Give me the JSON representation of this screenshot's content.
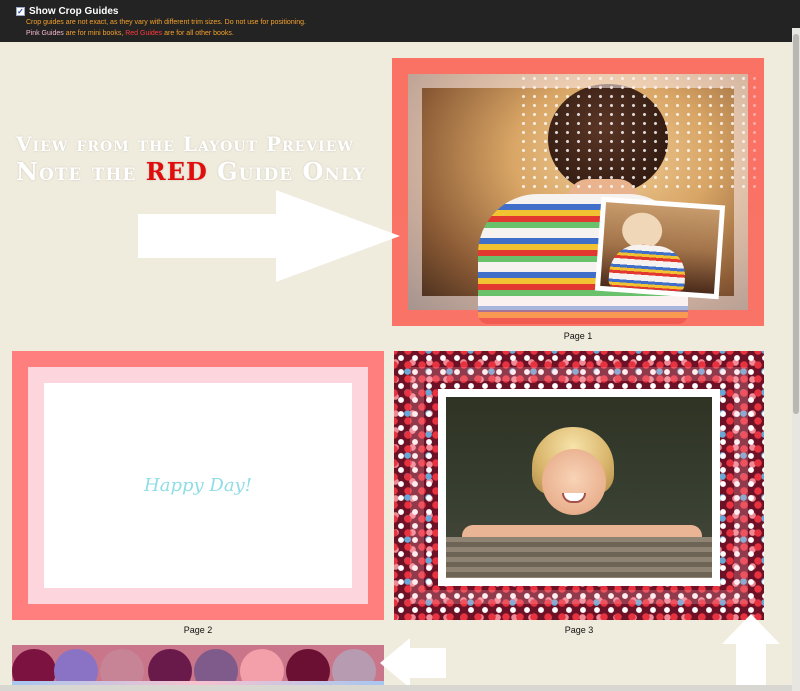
{
  "top_bar": {
    "checkbox_checked": true,
    "title": "Show Crop Guides",
    "note1": "Crop guides are not exact, as they vary with different trim sizes. Do not use for positioning.",
    "note2": {
      "pink_guides": "Pink Guides",
      "text_a": " are for mini books, ",
      "red_guides": "Red Guides",
      "text_b": " are for all other books."
    }
  },
  "annotation": {
    "line1": "View from the Layout Preview",
    "line2_prefix": "Note the ",
    "line2_highlight": "RED",
    "line2_suffix": " Guide Only"
  },
  "pages": [
    {
      "label": "Page 1"
    },
    {
      "label": "Page 2",
      "text": "Happy Day!"
    },
    {
      "label": "Page 3"
    }
  ],
  "colors": {
    "background": "#efebdd",
    "top_bar": "#232323",
    "red_guide": "#ff7f7f",
    "pink_guide": "#fcd6dc",
    "annotation_highlight": "#e00d0d"
  },
  "icons": [
    "checkbox-checked-icon",
    "right-arrow-icon",
    "left-arrow-icon",
    "up-arrow-icon"
  ]
}
